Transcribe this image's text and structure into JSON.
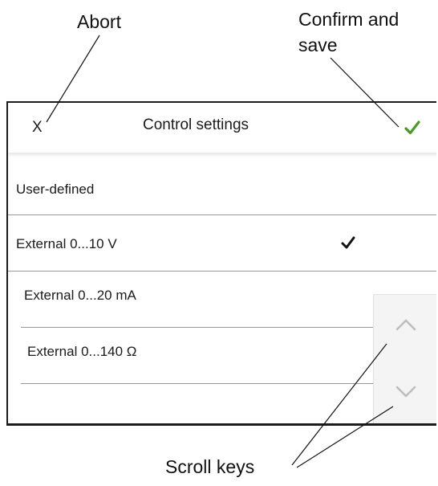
{
  "annotations": {
    "abort": "Abort",
    "confirm_line1": "Confirm and",
    "confirm_line2": "save",
    "scroll_keys": "Scroll keys"
  },
  "dialog": {
    "abort_label": "X",
    "title": "Control settings",
    "confirm_icon": "checkmark-icon",
    "confirm_color": "#4a9a2a"
  },
  "options": [
    {
      "label": "User-defined",
      "selected": false
    },
    {
      "label": "External 0...10 V",
      "selected": true
    },
    {
      "label": "External 0...20 mA",
      "selected": false
    },
    {
      "label": "External 0...140 Ω",
      "selected": false
    }
  ],
  "scroll": {
    "up_icon": "chevron-up-icon",
    "down_icon": "chevron-down-icon"
  }
}
